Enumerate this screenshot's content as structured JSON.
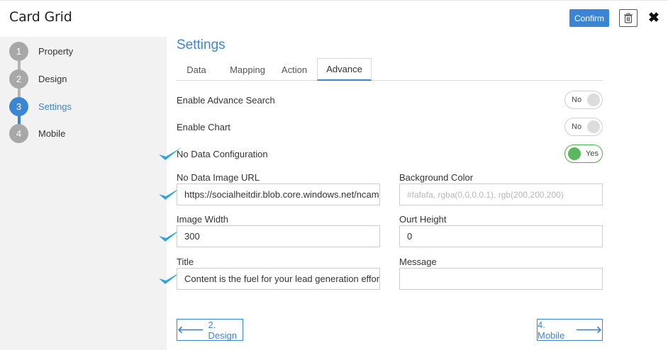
{
  "header": {
    "title": "Card Grid",
    "confirm_label": "Confirm",
    "trash_icon": "trash-icon",
    "close_icon": "close-icon"
  },
  "sidebar": {
    "steps": [
      {
        "number": "1",
        "label": "Property",
        "active": false
      },
      {
        "number": "2",
        "label": "Design",
        "active": false
      },
      {
        "number": "3",
        "label": "Settings",
        "active": true
      },
      {
        "number": "4",
        "label": "Mobile",
        "active": false
      }
    ]
  },
  "main": {
    "section_title": "Settings",
    "tabs": [
      {
        "label": "Data",
        "active": false
      },
      {
        "label": "Mapping",
        "active": false
      },
      {
        "label": "Action",
        "active": false
      },
      {
        "label": "Advance",
        "active": true
      }
    ],
    "toggles": [
      {
        "label": "Enable Advance Search",
        "state": "No"
      },
      {
        "label": "Enable Chart",
        "state": "No"
      },
      {
        "label": "No Data Configuration",
        "state": "Yes"
      }
    ],
    "fields": {
      "no_data_image_url": {
        "label": "No Data Image URL",
        "value": "https://socialheitdir.blob.core.windows.net/ncam"
      },
      "background_color": {
        "label": "Background Color",
        "placeholder": "#fafafa, rgba(0,0,0,0.1), rgb(200,200,200)"
      },
      "image_width": {
        "label": "Image Width",
        "value": "300"
      },
      "ourt_height": {
        "label": "Ourt Height",
        "value": "0"
      },
      "title": {
        "label": "Title",
        "value": "Content is the fuel for your lead generation effor"
      },
      "message": {
        "label": "Message",
        "value": ""
      }
    },
    "prev_button": {
      "label": "2. Design",
      "icon": "arrow-left-icon"
    },
    "next_button": {
      "label": "4. Mobile",
      "icon": "arrow-right-icon"
    }
  },
  "colors": {
    "accent": "#3b86d4",
    "toggle_on": "#5cb85c",
    "checkmark": "#2ea3dc",
    "sidebar_bg": "#f2f2f2",
    "step_inactive": "#a8a8a8"
  }
}
